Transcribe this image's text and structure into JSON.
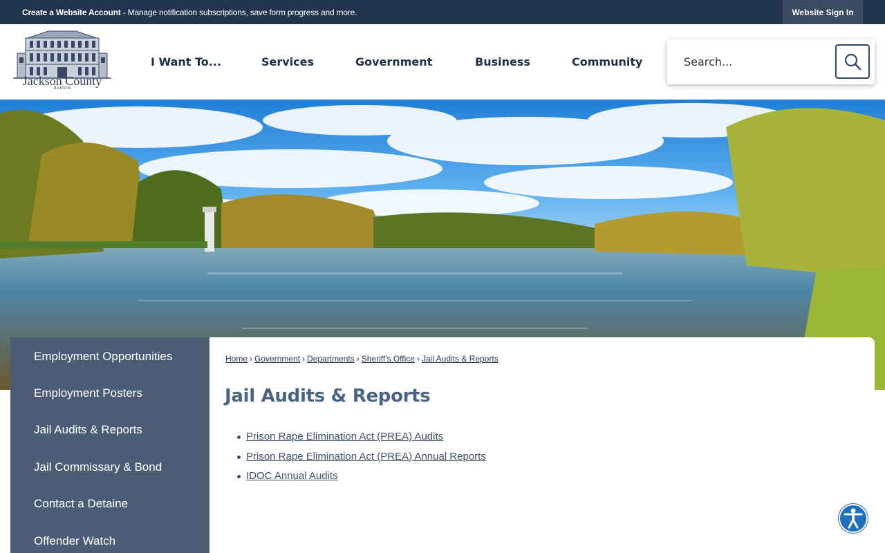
{
  "topbar": {
    "account_strong": "Create a Website Account",
    "account_text": " - Manage notification subscriptions, save form progress and more.",
    "signin_label": "Website Sign In"
  },
  "logo": {
    "text": "Jackson County",
    "subtext": "ILLINOIS"
  },
  "nav": {
    "items": [
      "I Want To...",
      "Services",
      "Government",
      "Business",
      "Community"
    ]
  },
  "search": {
    "placeholder": "Search..."
  },
  "sidebar": {
    "items": [
      "Employment Opportunities",
      "Employment Posters",
      "Jail Audits & Reports",
      "Jail Commissary & Bond",
      "Contact a Detaine",
      "Offender Watch"
    ]
  },
  "breadcrumb": [
    "Home",
    "Government",
    "Departments",
    "Sheriff's Office",
    "Jail Audits & Reports"
  ],
  "page": {
    "title": "Jail Audits & Reports",
    "links": [
      "Prison Rape Elimination Act (PREA) Audits",
      "Prison Rape Elimination Act (PREA) Annual Reports",
      "IDOC Annual Audits"
    ]
  },
  "colors": {
    "topbar": "#22354f",
    "sidebar": "#4a5d74",
    "title": "#4a6384",
    "nav_text": "#1f2f47",
    "accessibility": "#1e6fbf"
  },
  "icons": {
    "search": "magnifier-icon",
    "accessibility": "accessibility-icon"
  }
}
